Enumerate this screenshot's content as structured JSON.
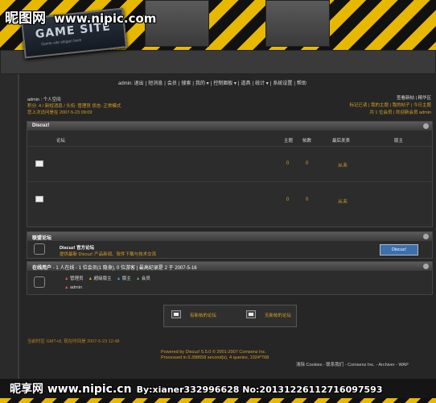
{
  "watermark": {
    "logo": "昵图网",
    "url": "www.nipic.com",
    "bottom_logo": "昵享网",
    "bottom_url": "www.nipic.cn",
    "bottom_id": "By:xianer332996628 No:20131226112716097593"
  },
  "site_logo": {
    "title": "GAME SITE",
    "subtitle": "Game site slogan here"
  },
  "nav": [
    "admin: 退出",
    "短消息",
    "会员",
    "搜索",
    "我的 ▾",
    "控制面板 ▾",
    "道具",
    "统计 ▾",
    "系统设置",
    "帮助"
  ],
  "user": {
    "line1": "admin : 个人空间",
    "line2": "积分: 4 / 新短消息 / 头衔: 管理员 状态: 正常模式",
    "line3": "您上次访问是在 2007-5-23 09:09"
  },
  "tools": {
    "line1": "查看新帖 | 精华区",
    "line2": "标记已读 | 我的主题 | 我的帖子 | 今日主题",
    "line3": "共 1 位会员 | 欢迎新会员 admin"
  },
  "forum": {
    "title": "Discuz!",
    "columns": {
      "forum": "论坛",
      "threads": "主题",
      "posts": "帖数",
      "lastpost": "最后发表",
      "moderator": "版主"
    },
    "rows": [
      {
        "threads": "0",
        "posts": "0",
        "lastpost": "从未"
      },
      {
        "threads": "0",
        "posts": "0",
        "lastpost": "从未"
      }
    ]
  },
  "links": {
    "title": "联盟论坛",
    "name": "Discuz! 官方论坛",
    "desc": "提供最新 Discuz! 产品新闻、软件下载与技术交流",
    "badge": "Discuz!"
  },
  "online": {
    "title": "在线用户",
    "summary": "- 1 人在线 - 1 位会员(1 隐身), 0 位游客 | 最高纪录是 2 于 2007-5-16",
    "legend": [
      "管理员",
      "超级版主",
      "版主",
      "会员"
    ],
    "users": [
      "admin"
    ]
  },
  "legend_bottom": {
    "new": "有新帖的论坛",
    "nonew": "无新帖的论坛"
  },
  "footer": {
    "left1": "当前时区 GMT+8, 现在时间是 2007-5-23 12:48",
    "powered": "Powered by Discuz! 5.5.0 © 2001-2007 Comsenz Inc.",
    "processed": "Processed in 0.398658 second(s), 4 queries, 1024*768",
    "links": "清除 Cookies - 联系我们 - Comsenz Inc. - Archiver - WAP"
  },
  "colors": {
    "accent": "#d9a020",
    "stripe_yellow": "#e6b800"
  }
}
